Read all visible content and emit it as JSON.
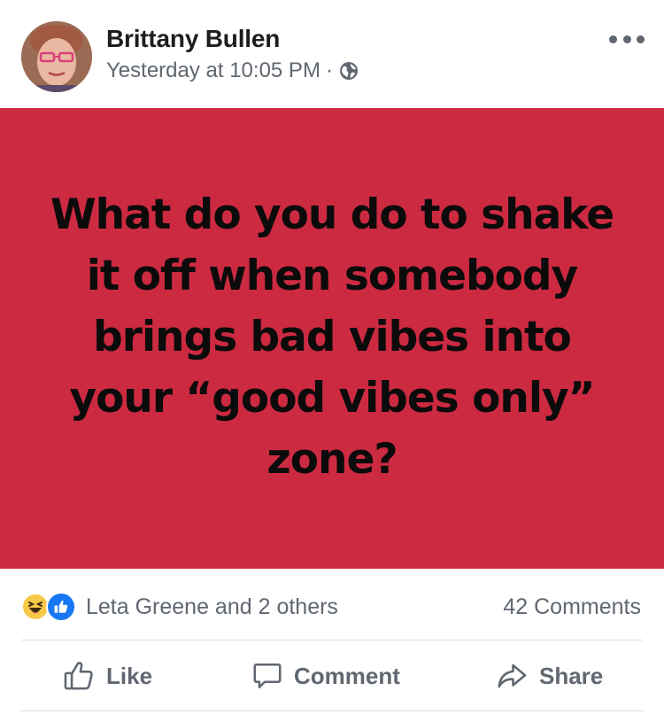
{
  "post": {
    "author": "Brittany Bullen",
    "timestamp": "Yesterday at 10:05 PM",
    "separator": "·",
    "privacy_icon": "globe-icon",
    "menu_icon": "more-options-icon",
    "background_color": "#cc2a41",
    "text": "What do you do to shake it off when somebody brings bad vibes into your “good vibes only” zone?"
  },
  "reactions": {
    "icons": [
      "haha-icon",
      "like-icon"
    ],
    "summary": "Leta Greene and 2 others",
    "comments": "42 Comments",
    "like_color": "#1877f2"
  },
  "actions": {
    "like": "Like",
    "comment": "Comment",
    "share": "Share"
  }
}
